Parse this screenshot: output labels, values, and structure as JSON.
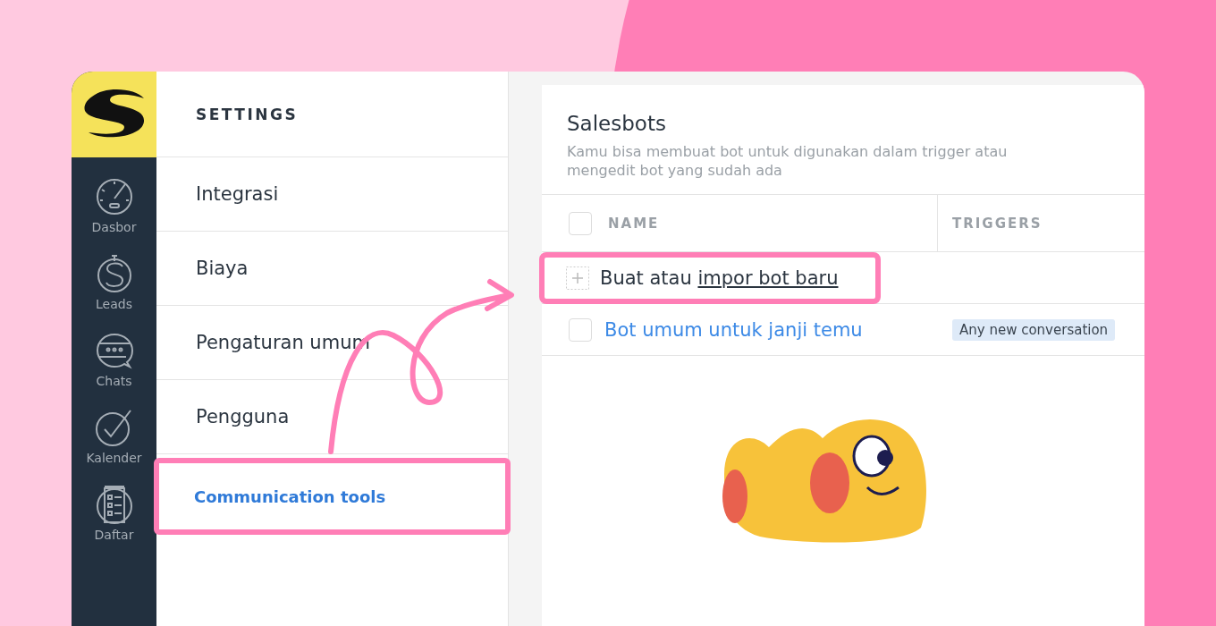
{
  "nav": {
    "items": [
      {
        "label": "Dasbor",
        "kind": "gauge"
      },
      {
        "label": "Leads",
        "kind": "dollar"
      },
      {
        "label": "Chats",
        "kind": "chat"
      },
      {
        "label": "Kalender",
        "kind": "check"
      },
      {
        "label": "Daftar",
        "kind": "list"
      }
    ]
  },
  "settings": {
    "title": "SETTINGS",
    "items": [
      {
        "label": "Integrasi",
        "selected": false
      },
      {
        "label": "Biaya",
        "selected": false
      },
      {
        "label": "Pengaturan umum",
        "selected": false
      },
      {
        "label": "Pengguna",
        "selected": false
      },
      {
        "label": "Communication tools",
        "selected": true
      }
    ]
  },
  "panel": {
    "title": "Salesbots",
    "description": "Kamu bisa membuat bot untuk digunakan dalam trigger atau mengedit bot yang sudah ada",
    "columns": [
      "NAME",
      "TRIGGERS"
    ],
    "select_all_checked": false,
    "add_row": {
      "text": "Buat atau",
      "link": "impor bot baru"
    },
    "rows": [
      {
        "name": "Bot umum untuk janji temu",
        "trigger": "Any new conversation",
        "checked": false
      }
    ]
  }
}
